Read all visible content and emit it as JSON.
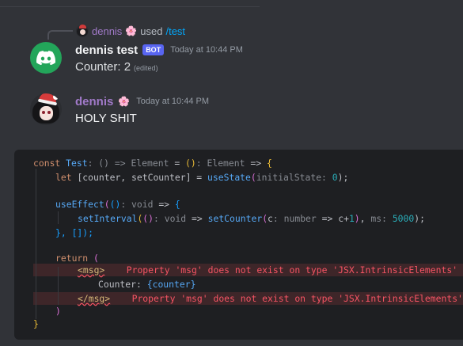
{
  "reply": {
    "author": "dennis",
    "author_emoji": "🌸",
    "used_text": "used",
    "command": "/test"
  },
  "bot_message": {
    "author": "dennis test",
    "badge": "BOT",
    "timestamp": "Today at 10:44 PM",
    "content": "Counter: 2",
    "edited": "(edited)"
  },
  "user_message": {
    "author": "dennis",
    "author_emoji": "🌸",
    "timestamp": "Today at 10:44 PM",
    "content": "HOLY SHIT"
  },
  "code": {
    "l1": {
      "const": "const",
      "name": "Test",
      "hint1": ": () => Element",
      "eq": " = ",
      "p": "()",
      "hint2": ": Element",
      "arrow": " => ",
      "brace": "{"
    },
    "l2": {
      "let": "let",
      "destruct": "[counter, setCounter]",
      "eq": " = ",
      "fn": "useState",
      "open": "(",
      "hint": "initialState: ",
      "num": "0",
      "close": ");"
    },
    "l4": {
      "fn": "useEffect",
      "open": "(",
      "p": "()",
      "hint": ": void",
      "arrow": " => ",
      "brace": "{"
    },
    "l5": {
      "fn": "setInterval",
      "open": "(",
      "p": "()",
      "hint": ": void",
      "arrow": " => ",
      "fn2": "setCounter",
      "open2": "(",
      "param": "c",
      "hint2": ": number",
      "arrow2": " => ",
      "expr1": "c+",
      "num1": "1",
      "close2": ")",
      "comma": ", ",
      "hint3": "ms: ",
      "num2": "5000",
      "close": ");"
    },
    "l6": {
      "text": "}, []);"
    },
    "l8": {
      "kw": "return",
      "paren": " ("
    },
    "l9": {
      "tag": "<msg>",
      "error": "Property 'msg' does not exist on type 'JSX.IntrinsicElements'"
    },
    "l10": {
      "text": "Counter: ",
      "expr": "{counter}"
    },
    "l11": {
      "tag": "</msg>",
      "error": "Property 'msg' does not exist on type 'JSX.IntrinsicElements'"
    },
    "l12": {
      "paren": ")"
    },
    "l13": {
      "brace": "}"
    }
  },
  "colors": {
    "background": "#313338",
    "code_background": "#1e1f22",
    "bot_avatar": "#23a55a",
    "bot_badge": "#5865f2",
    "username_purple": "#a17ac9",
    "command_link": "#00a8fc",
    "error_red": "#f75464"
  },
  "icons": {
    "bot_avatar": "discord-logo-icon"
  }
}
